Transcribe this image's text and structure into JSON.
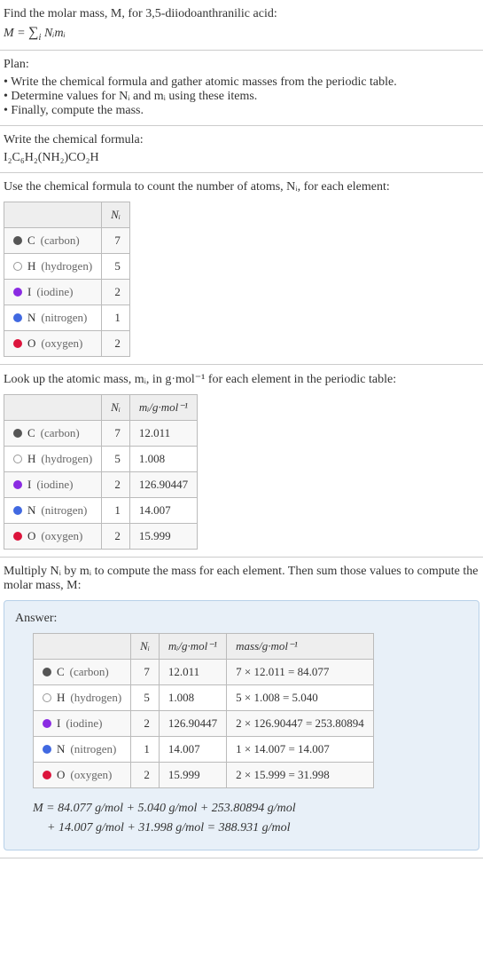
{
  "intro": {
    "line1": "Find the molar mass, M, for 3,5-diiodoanthranilic acid:",
    "formula_prefix": "M = ",
    "formula_sigma": "∑",
    "formula_sub": "i",
    "formula_rest": " Nᵢmᵢ"
  },
  "plan": {
    "title": "Plan:",
    "item1": "• Write the chemical formula and gather atomic masses from the periodic table.",
    "item2": "• Determine values for Nᵢ and mᵢ using these items.",
    "item3": "• Finally, compute the mass."
  },
  "formula_section": {
    "title": "Write the chemical formula:",
    "formula": "I₂C₆H₂(NH₂)CO₂H"
  },
  "count_section": {
    "title": "Use the chemical formula to count the number of atoms, Nᵢ, for each element:",
    "header_ni": "Nᵢ",
    "rows": [
      {
        "color": "#555",
        "symbol": "C",
        "name": "(carbon)",
        "n": "7"
      },
      {
        "color": "#fff",
        "border": "#999",
        "symbol": "H",
        "name": "(hydrogen)",
        "n": "5"
      },
      {
        "color": "#8a2be2",
        "symbol": "I",
        "name": "(iodine)",
        "n": "2"
      },
      {
        "color": "#4169e1",
        "symbol": "N",
        "name": "(nitrogen)",
        "n": "1"
      },
      {
        "color": "#dc143c",
        "symbol": "O",
        "name": "(oxygen)",
        "n": "2"
      }
    ]
  },
  "mass_section": {
    "title": "Look up the atomic mass, mᵢ, in g·mol⁻¹ for each element in the periodic table:",
    "header_ni": "Nᵢ",
    "header_mi": "mᵢ/g·mol⁻¹",
    "rows": [
      {
        "color": "#555",
        "symbol": "C",
        "name": "(carbon)",
        "n": "7",
        "m": "12.011"
      },
      {
        "color": "#fff",
        "border": "#999",
        "symbol": "H",
        "name": "(hydrogen)",
        "n": "5",
        "m": "1.008"
      },
      {
        "color": "#8a2be2",
        "symbol": "I",
        "name": "(iodine)",
        "n": "2",
        "m": "126.90447"
      },
      {
        "color": "#4169e1",
        "symbol": "N",
        "name": "(nitrogen)",
        "n": "1",
        "m": "14.007"
      },
      {
        "color": "#dc143c",
        "symbol": "O",
        "name": "(oxygen)",
        "n": "2",
        "m": "15.999"
      }
    ]
  },
  "compute_section": {
    "title": "Multiply Nᵢ by mᵢ to compute the mass for each element. Then sum those values to compute the molar mass, M:"
  },
  "answer": {
    "title": "Answer:",
    "header_ni": "Nᵢ",
    "header_mi": "mᵢ/g·mol⁻¹",
    "header_mass": "mass/g·mol⁻¹",
    "rows": [
      {
        "color": "#555",
        "symbol": "C",
        "name": "(carbon)",
        "n": "7",
        "m": "12.011",
        "calc": "7 × 12.011 = 84.077"
      },
      {
        "color": "#fff",
        "border": "#999",
        "symbol": "H",
        "name": "(hydrogen)",
        "n": "5",
        "m": "1.008",
        "calc": "5 × 1.008 = 5.040"
      },
      {
        "color": "#8a2be2",
        "symbol": "I",
        "name": "(iodine)",
        "n": "2",
        "m": "126.90447",
        "calc": "2 × 126.90447 = 253.80894"
      },
      {
        "color": "#4169e1",
        "symbol": "N",
        "name": "(nitrogen)",
        "n": "1",
        "m": "14.007",
        "calc": "1 × 14.007 = 14.007"
      },
      {
        "color": "#dc143c",
        "symbol": "O",
        "name": "(oxygen)",
        "n": "2",
        "m": "15.999",
        "calc": "2 × 15.999 = 31.998"
      }
    ],
    "result_line1": "M = 84.077 g/mol + 5.040 g/mol + 253.80894 g/mol",
    "result_line2": "+ 14.007 g/mol + 31.998 g/mol = 388.931 g/mol"
  }
}
